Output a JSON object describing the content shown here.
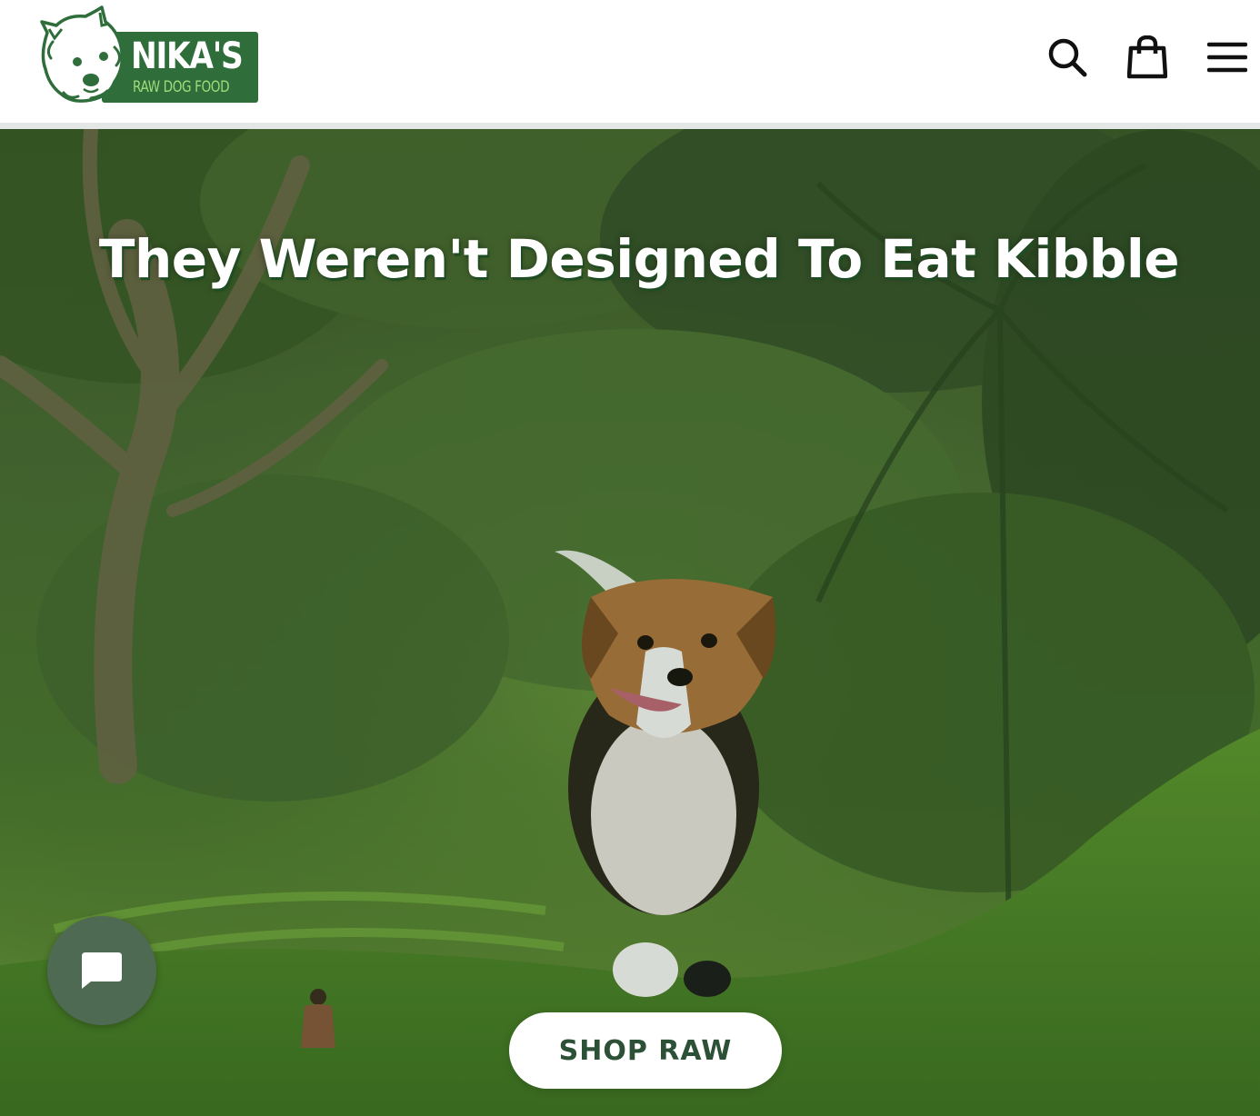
{
  "brand": {
    "name": "NIKA'S",
    "tagline": "RAW DOG FOOD",
    "colors": {
      "primary": "#2f6e3b",
      "tagline": "#9fdc7a"
    }
  },
  "header": {
    "icons": [
      "search-icon",
      "shopping-bag-icon",
      "hamburger-menu-icon"
    ]
  },
  "hero": {
    "title": "They Weren't Designed To Eat Kibble",
    "cta_label": "SHOP RAW",
    "image_description_icons": [
      "beagle-dog",
      "jungle-trees",
      "rice-terraces"
    ]
  },
  "chat": {
    "icon": "chat-bubble-icon",
    "color": "#4f6a52"
  }
}
